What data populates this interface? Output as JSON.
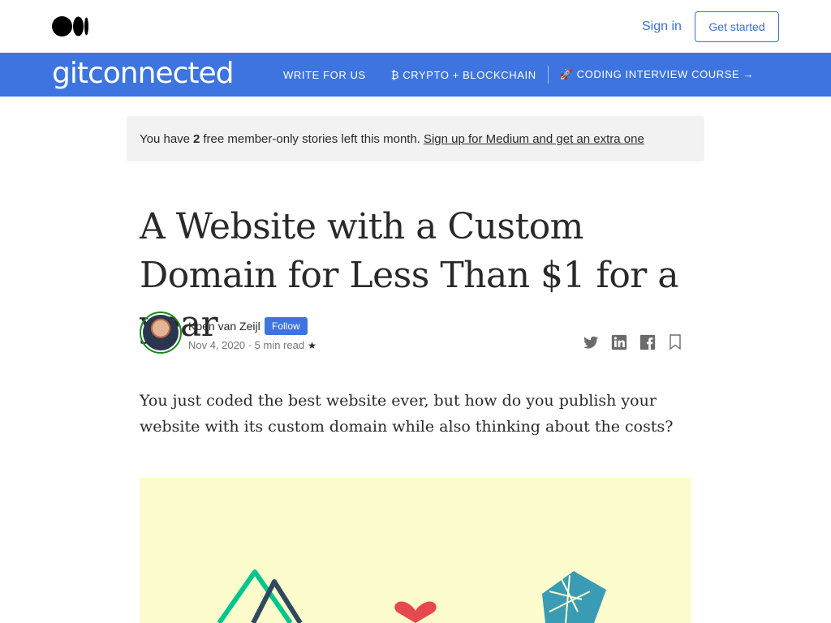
{
  "header": {
    "sign_in": "Sign in",
    "get_started": "Get started"
  },
  "publication": {
    "name": "gitconnected",
    "nav": [
      {
        "label": "WRITE FOR US"
      },
      {
        "label": "₿ CRYPTO + BLOCKCHAIN"
      },
      {
        "label": "🚀 CODING INTERVIEW COURSE →"
      }
    ],
    "bar_color": "#3d74df"
  },
  "banner": {
    "prefix": "You have",
    "count": "2",
    "middle": "free member-only stories left this month.",
    "link": "Sign up for Medium and get an extra one"
  },
  "article": {
    "title": "A Website with a Custom Domain for Less Than $1 for a year",
    "author": "Koen van Zeijl",
    "follow": "Follow",
    "date_read": "Nov 4, 2020 · 5 min read",
    "star": "★",
    "intro": "You just coded the best website ever, but how do you publish your website with its custom domain while also thinking about the costs?"
  },
  "icons": {
    "share": [
      "twitter-icon",
      "linkedin-icon",
      "facebook-icon",
      "bookmark-icon"
    ]
  },
  "colors": {
    "accent": "#3c6fd8",
    "hero_bg": "#fdfccc",
    "heart": "#e5484d",
    "nuxt_green": "#00c58e",
    "nuxt_dark": "#2f495e",
    "netlify_teal": "#3a9bb5"
  }
}
